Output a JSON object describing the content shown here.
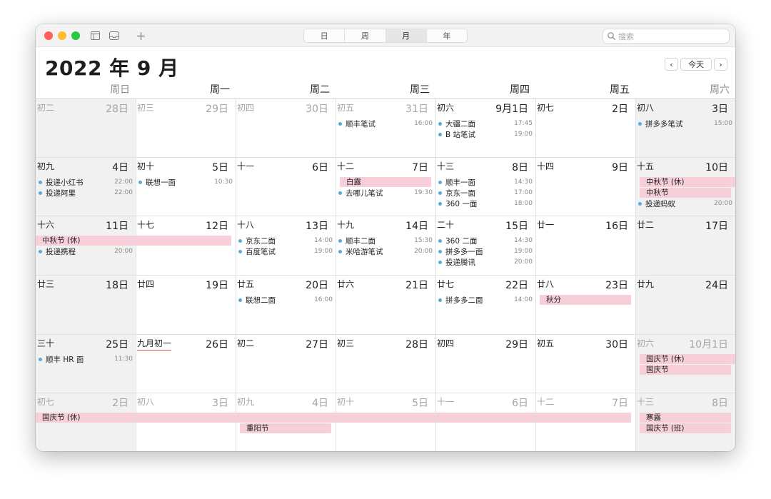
{
  "toolbar": {
    "views": [
      {
        "label": "日",
        "active": false
      },
      {
        "label": "周",
        "active": false
      },
      {
        "label": "月",
        "active": true
      },
      {
        "label": "年",
        "active": false
      }
    ],
    "search_placeholder": "搜索",
    "icons": [
      "calendar-list-icon",
      "inbox-icon",
      "plus-icon",
      "search-icon"
    ],
    "traffic_colors": [
      "#ff5f57",
      "#febc2e",
      "#28c840"
    ]
  },
  "header": {
    "title": "2022 年 9 月",
    "prev": "‹",
    "today": "今天",
    "next": "›"
  },
  "weekdays": [
    "周日",
    "周一",
    "周二",
    "周三",
    "周四",
    "周五",
    "周六"
  ],
  "weeks": [
    [
      {
        "lunar": "初二",
        "day": "28日",
        "dim": true,
        "events": []
      },
      {
        "lunar": "初三",
        "day": "29日",
        "dim": true,
        "events": []
      },
      {
        "lunar": "初四",
        "day": "30日",
        "dim": true,
        "events": []
      },
      {
        "lunar": "初五",
        "day": "31日",
        "dim": true,
        "events": [
          {
            "name": "顺丰笔试",
            "time": "16:00"
          }
        ]
      },
      {
        "lunar": "初六",
        "day": "9月1日",
        "dim": false,
        "events": [
          {
            "name": "大疆二面",
            "time": "17:45"
          },
          {
            "name": "B 站笔试",
            "time": "19:00"
          }
        ]
      },
      {
        "lunar": "初七",
        "day": "2日",
        "dim": false,
        "events": []
      },
      {
        "lunar": "初八",
        "day": "3日",
        "dim": false,
        "events": [
          {
            "name": "拼多多笔试",
            "time": "15:00"
          }
        ]
      }
    ],
    [
      {
        "lunar": "初九",
        "day": "4日",
        "dim": false,
        "events": [
          {
            "name": "投递小红书",
            "time": "22:00"
          },
          {
            "name": "投递阿里",
            "time": "22:00"
          }
        ]
      },
      {
        "lunar": "初十",
        "day": "5日",
        "dim": false,
        "events": [
          {
            "name": "联想一面",
            "time": "10:30"
          }
        ]
      },
      {
        "lunar": "十一",
        "day": "6日",
        "dim": false,
        "events": []
      },
      {
        "lunar": "十二",
        "day": "7日",
        "dim": false,
        "events": [
          {
            "name": "去哪儿笔试",
            "time": "19:30"
          }
        ]
      },
      {
        "lunar": "十三",
        "day": "8日",
        "dim": false,
        "events": [
          {
            "name": "顺丰一面",
            "time": "14:30"
          },
          {
            "name": "京东一面",
            "time": "17:00"
          },
          {
            "name": "360 一面",
            "time": "18:00"
          }
        ]
      },
      {
        "lunar": "十四",
        "day": "9日",
        "dim": false,
        "events": []
      },
      {
        "lunar": "十五",
        "day": "10日",
        "dim": false,
        "events": [
          {
            "name": "投递蚂蚁",
            "time": "20:00"
          }
        ]
      }
    ],
    [
      {
        "lunar": "十六",
        "day": "11日",
        "dim": false,
        "events": [
          {
            "name": "投递携程",
            "time": "20:00"
          }
        ]
      },
      {
        "lunar": "十七",
        "day": "12日",
        "dim": false,
        "events": []
      },
      {
        "lunar": "十八",
        "day": "13日",
        "dim": false,
        "events": [
          {
            "name": "京东二面",
            "time": "14:00"
          },
          {
            "name": "百度笔试",
            "time": "19:00"
          }
        ]
      },
      {
        "lunar": "十九",
        "day": "14日",
        "dim": false,
        "events": [
          {
            "name": "顺丰二面",
            "time": "15:30"
          },
          {
            "name": "米哈游笔试",
            "time": "20:00"
          }
        ]
      },
      {
        "lunar": "二十",
        "day": "15日",
        "dim": false,
        "events": [
          {
            "name": "360 二面",
            "time": "14:30"
          },
          {
            "name": "拼多多一面",
            "time": "19:00"
          },
          {
            "name": "投递腾讯",
            "time": "20:00"
          }
        ]
      },
      {
        "lunar": "廿一",
        "day": "16日",
        "dim": false,
        "events": []
      },
      {
        "lunar": "廿二",
        "day": "17日",
        "dim": false,
        "events": []
      }
    ],
    [
      {
        "lunar": "廿三",
        "day": "18日",
        "dim": false,
        "events": []
      },
      {
        "lunar": "廿四",
        "day": "19日",
        "dim": false,
        "events": []
      },
      {
        "lunar": "廿五",
        "day": "20日",
        "dim": false,
        "events": [
          {
            "name": "联想二面",
            "time": "16:00"
          }
        ]
      },
      {
        "lunar": "廿六",
        "day": "21日",
        "dim": false,
        "events": []
      },
      {
        "lunar": "廿七",
        "day": "22日",
        "dim": false,
        "events": [
          {
            "name": "拼多多二面",
            "time": "14:00"
          }
        ]
      },
      {
        "lunar": "廿八",
        "day": "23日",
        "dim": false,
        "events": []
      },
      {
        "lunar": "廿九",
        "day": "24日",
        "dim": false,
        "events": []
      }
    ],
    [
      {
        "lunar": "三十",
        "day": "25日",
        "dim": false,
        "events": [
          {
            "name": "顺丰 HR 面",
            "time": "11:30"
          }
        ]
      },
      {
        "lunar": "九月初一",
        "day": "26日",
        "dim": false,
        "underline": true,
        "events": []
      },
      {
        "lunar": "初二",
        "day": "27日",
        "dim": false,
        "events": []
      },
      {
        "lunar": "初三",
        "day": "28日",
        "dim": false,
        "events": []
      },
      {
        "lunar": "初四",
        "day": "29日",
        "dim": false,
        "events": []
      },
      {
        "lunar": "初五",
        "day": "30日",
        "dim": false,
        "events": []
      },
      {
        "lunar": "初六",
        "day": "10月1日",
        "dim": true,
        "events": []
      }
    ],
    [
      {
        "lunar": "初七",
        "day": "2日",
        "dim": true,
        "events": []
      },
      {
        "lunar": "初八",
        "day": "3日",
        "dim": true,
        "events": []
      },
      {
        "lunar": "初九",
        "day": "4日",
        "dim": true,
        "events": []
      },
      {
        "lunar": "初十",
        "day": "5日",
        "dim": true,
        "events": []
      },
      {
        "lunar": "十一",
        "day": "6日",
        "dim": true,
        "events": []
      },
      {
        "lunar": "十二",
        "day": "7日",
        "dim": true,
        "events": []
      },
      {
        "lunar": "十三",
        "day": "8日",
        "dim": true,
        "events": []
      }
    ]
  ],
  "allday": [
    {
      "label": "白露",
      "week": 1,
      "start": 3,
      "span": 1,
      "slot": 0
    },
    {
      "label": "中秋节 (休)",
      "week": 1,
      "start": 6,
      "span": 1,
      "slot": 0
    },
    {
      "label": "中秋节",
      "week": 1,
      "start": 6,
      "span": 1,
      "slot": 1
    },
    {
      "label": "中秋节 (休)",
      "week": 2,
      "start": 0,
      "span": 2,
      "slot": 0
    },
    {
      "label": "秋分",
      "week": 3,
      "start": 5,
      "span": 1,
      "slot": 0
    },
    {
      "label": "国庆节 (休)",
      "week": 4,
      "start": 6,
      "span": 1,
      "slot": 0
    },
    {
      "label": "国庆节",
      "week": 4,
      "start": 6,
      "span": 1,
      "slot": 1
    },
    {
      "label": "国庆节 (休)",
      "week": 5,
      "start": 0,
      "span": 6,
      "slot": 0
    },
    {
      "label": "寒露",
      "week": 5,
      "start": 6,
      "span": 1,
      "slot": 0
    },
    {
      "label": "重阳节",
      "week": 5,
      "start": 2,
      "span": 1,
      "slot": 1
    },
    {
      "label": "国庆节 (班)",
      "week": 5,
      "start": 6,
      "span": 1,
      "slot": 1
    }
  ],
  "colors": {
    "event_dot": "#5aa9d6",
    "allday_bg": "#f6cfd9",
    "weekend_bg": "#f1f1f1",
    "today_underline": "#e2564b"
  }
}
